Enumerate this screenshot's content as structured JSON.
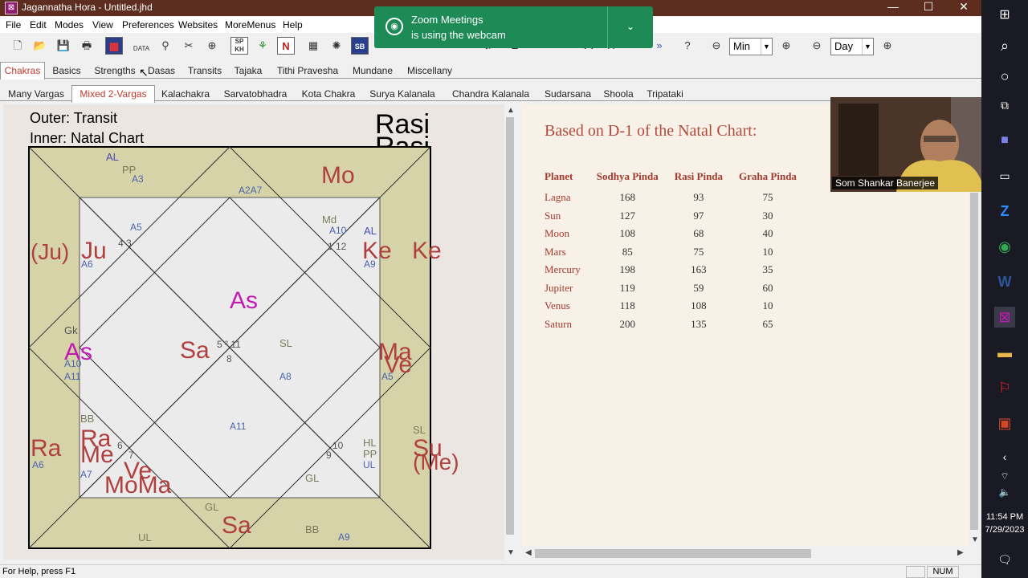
{
  "window": {
    "title": "Jagannatha Hora - Untitled.jhd",
    "minimize": "—",
    "maximize": "☐",
    "close": "✕"
  },
  "menu": [
    "File",
    "Edit",
    "Modes",
    "View",
    "Preferences",
    "Websites",
    "MoreMenus",
    "Help"
  ],
  "toolbar": {
    "min_select": "Min",
    "day_select": "Day",
    "data_label": "DATA",
    "sp_label": "SP KH",
    "n_label": "N",
    "sb_label": "SB"
  },
  "tabs_main": [
    "Chakras",
    "Basics",
    "Strengths",
    "Dasas",
    "Transits",
    "Tajaka",
    "Tithi Pravesha",
    "Mundane",
    "Miscellany"
  ],
  "tabs_sub": [
    "Many Vargas",
    "Mixed 2-Vargas",
    "Kalachakra",
    "Sarvatobhadra",
    "Kota Chakra",
    "Surya Kalanala",
    "Chandra Kalanala",
    "Sudarsana",
    "Shoola",
    "Tripataki"
  ],
  "chart": {
    "outer_label": "Outer: Transit",
    "inner_label": "Inner: Natal Chart",
    "heading": "Rasi",
    "heading2": "Rasi",
    "colors": {
      "planet": "#b04040",
      "lagna": "#c21bb3",
      "arudha": "#4a63b0",
      "special": "#7a7a5a",
      "frame": "#d6d3a8"
    }
  },
  "pinda": {
    "title": "Based on D-1 of the Natal Chart:",
    "headers": [
      "Planet",
      "Sodhya Pinda",
      "Rasi Pinda",
      "Graha Pinda"
    ],
    "rows": [
      [
        "Lagna",
        "168",
        "93",
        "75"
      ],
      [
        "Sun",
        "127",
        "97",
        "30"
      ],
      [
        "Moon",
        "108",
        "68",
        "40"
      ],
      [
        "Mars",
        "85",
        "75",
        "10"
      ],
      [
        "Mercury",
        "198",
        "163",
        "35"
      ],
      [
        "Jupiter",
        "119",
        "59",
        "60"
      ],
      [
        "Venus",
        "118",
        "108",
        "10"
      ],
      [
        "Saturn",
        "200",
        "135",
        "65"
      ]
    ]
  },
  "status": {
    "help": "For Help, press F1",
    "num": "NUM"
  },
  "toast": {
    "line1": "Zoom Meetings",
    "line2": "is using the webcam"
  },
  "webcam": {
    "name": "Som Shankar Banerjee"
  },
  "taskbar": {
    "time": "11:54 PM",
    "date": "7/29/2023"
  }
}
